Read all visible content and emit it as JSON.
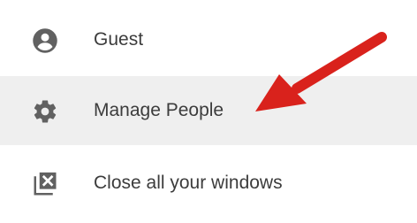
{
  "menu": {
    "items": [
      {
        "label": "Guest",
        "icon": "account-circle-icon"
      },
      {
        "label": "Manage People",
        "icon": "gear-icon",
        "highlighted": true
      },
      {
        "label": "Close all your windows",
        "icon": "close-windows-icon"
      }
    ]
  },
  "annotation": {
    "arrow_color": "#d9221c",
    "points_to": "Manage People"
  },
  "colors": {
    "highlight_background": "#efefef",
    "text": "#3c3c3c",
    "icon": "#616161"
  }
}
